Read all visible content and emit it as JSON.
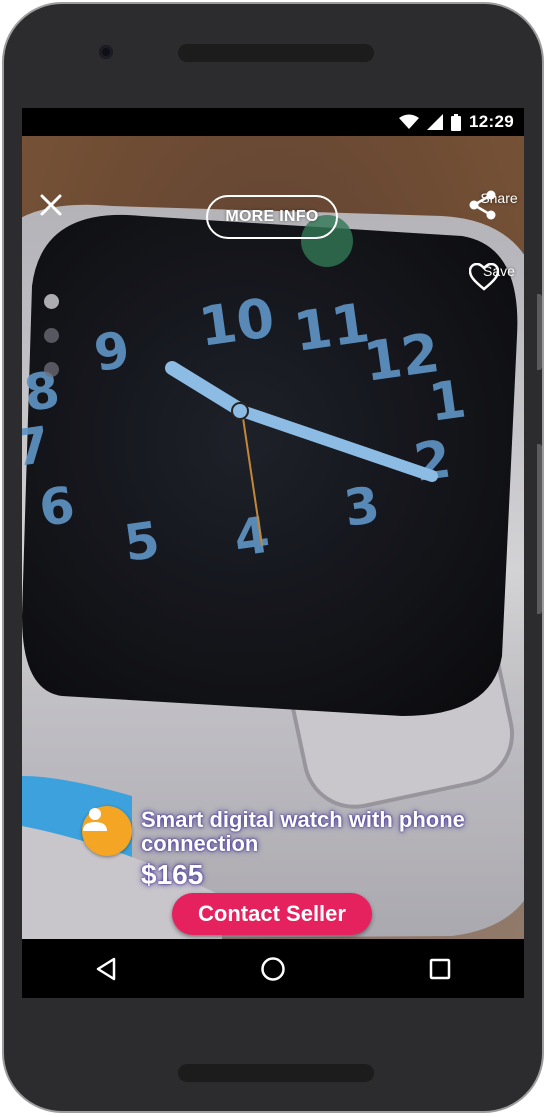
{
  "status_bar": {
    "time": "12:29",
    "icons": [
      "wifi-icon",
      "cell-signal-icon",
      "battery-icon"
    ]
  },
  "top_bar": {
    "close_icon": "close-icon",
    "more_info_label": "MORE INFO",
    "share_label": "Share",
    "save_label": "Save"
  },
  "gallery": {
    "page_count": 3,
    "active_index": 0
  },
  "listing": {
    "title": "Smart digital watch with phone connection",
    "price": "$165",
    "seller_avatar_icon": "person-icon",
    "contact_button_label": "Contact Seller"
  },
  "photo_watch_numerals": [
    "10",
    "11",
    "12",
    "1",
    "2",
    "3",
    "4",
    "5",
    "6",
    "7",
    "8",
    "9"
  ],
  "nav_bar": {
    "icons": [
      "back-triangle-icon",
      "home-circle-icon",
      "recents-square-icon"
    ]
  },
  "colors": {
    "accent": "#e5215e",
    "avatar": "#f5a524",
    "frame": "#2c2b2d"
  }
}
